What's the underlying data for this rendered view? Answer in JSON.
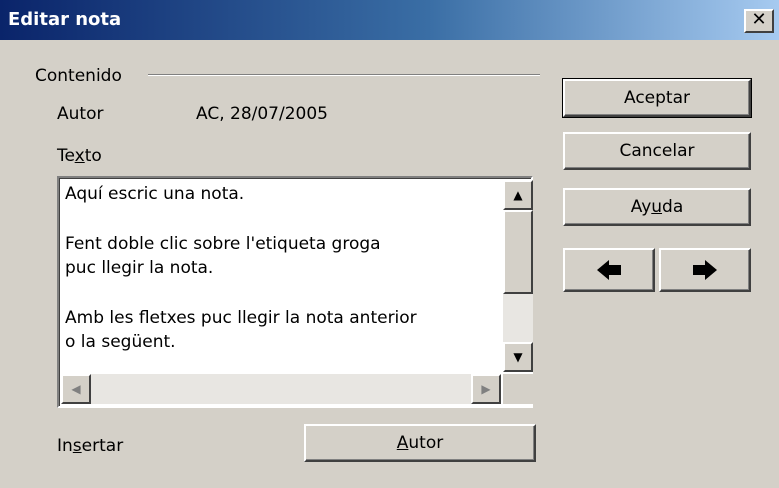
{
  "window": {
    "title": "Editar nota",
    "close_glyph": "✕"
  },
  "content": {
    "group_label": "Contenido",
    "author_label": "Autor",
    "author_value": "AC, 28/07/2005",
    "text_label_pre": "Te",
    "text_label_ul": "x",
    "text_label_post": "to",
    "note_lines": [
      "Aquí escric una nota.",
      "Fent doble clic sobre l'etiqueta groga",
      "puc llegir la nota.",
      "Amb les fletxes puc llegir la nota anterior",
      "o la següent."
    ],
    "insert_label_pre": "In",
    "insert_label_ul": "s",
    "insert_label_post": "ertar",
    "author_button_ul": "A",
    "author_button_post": "utor"
  },
  "buttons": {
    "accept": "Aceptar",
    "cancel": "Cancelar",
    "help_pre": "Ay",
    "help_ul": "u",
    "help_post": "da",
    "prev_icon": "left-arrow-icon",
    "next_icon": "right-arrow-icon"
  },
  "scroll": {
    "up": "▲",
    "down": "▼",
    "left": "◀",
    "right": "▶"
  }
}
